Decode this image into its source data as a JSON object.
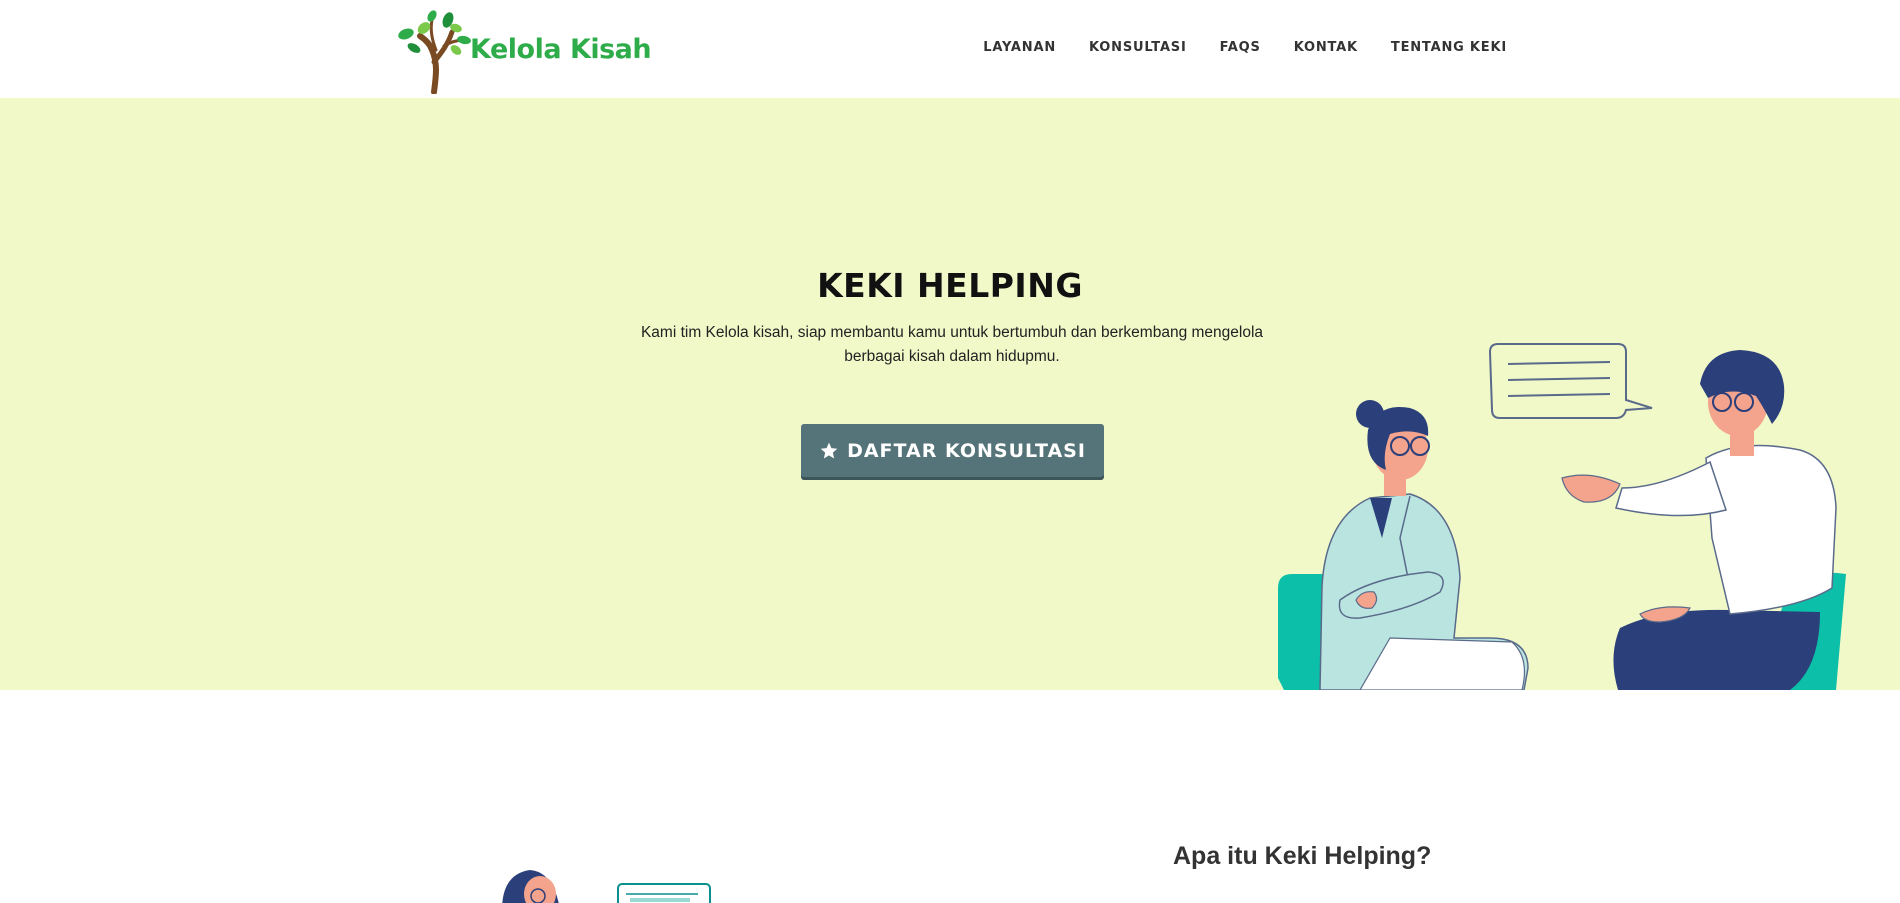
{
  "header": {
    "logo_text": "Kelola Kisah",
    "nav": [
      "LAYANAN",
      "KONSULTASI",
      "FAQS",
      "KONTAK",
      "TENTANG KEKI"
    ]
  },
  "hero": {
    "title": "KEKI HELPING",
    "description": "Kami tim Kelola kisah, siap membantu kamu untuk bertumbuh dan berkembang mengelola berbagai kisah dalam hidupmu.",
    "cta_label": "DAFTAR KONSULTASI",
    "cta_icon": "star-icon",
    "illustration": "consultation-illustration"
  },
  "about": {
    "title": "Apa itu Keki Helping?",
    "illustration": "person-illustration"
  },
  "colors": {
    "hero_bg": "#f1f9c9",
    "brand_green": "#2eac4a",
    "cta_bg": "#557479",
    "chair_teal": "#0bbfa8",
    "navy": "#2b3f7a"
  }
}
